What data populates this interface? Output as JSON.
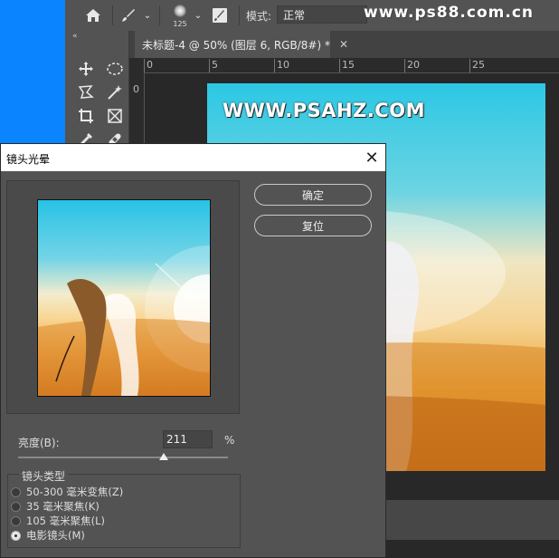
{
  "toolbar": {
    "brush_size": "125",
    "mode_label": "模式:",
    "mode_value": "正常",
    "watermark": "www.ps88.com.cn"
  },
  "document": {
    "tab_title": "未标题-4 @ 50% (图层 6, RGB/8#) *",
    "close_glyph": "✕",
    "ruler_h_labels": [
      "0",
      "5",
      "10",
      "15",
      "20",
      "25"
    ],
    "ruler_v_labels": [
      "0"
    ],
    "canvas_watermark": "WWW.PSAHZ.COM"
  },
  "dialog": {
    "title": "镜头光晕",
    "close_glyph": "✕",
    "ok_label": "确定",
    "reset_label": "复位",
    "brightness_label": "亮度(B):",
    "brightness_value": "211",
    "percent_sign": "%",
    "brightness_slider_value": 211,
    "brightness_slider_range": [
      10,
      300
    ],
    "lens_group_label": "镜头类型",
    "lens_options": [
      {
        "label": "50-300 毫米变焦(Z)",
        "selected": false
      },
      {
        "label": "35 毫米聚焦(K)",
        "selected": false
      },
      {
        "label": "105 毫米聚焦(L)",
        "selected": false
      },
      {
        "label": "电影镜头(M)",
        "selected": true
      }
    ]
  },
  "icons": {
    "home": "home-icon",
    "brush": "brush-icon",
    "brush_preset": "brush-preset-icon",
    "brush_settings": "brush-settings-icon",
    "move": "move-tool-icon",
    "ellipse": "elliptical-marquee-icon",
    "lasso": "polygonal-lasso-icon",
    "magic": "magic-wand-icon",
    "crop": "crop-tool-icon",
    "frame": "frame-tool-icon",
    "eyedropper": "eyedropper-icon",
    "healing": "healing-brush-icon"
  },
  "colors": {
    "desktop": "#0a84ff",
    "panel": "#535353",
    "workspace": "#282828"
  }
}
